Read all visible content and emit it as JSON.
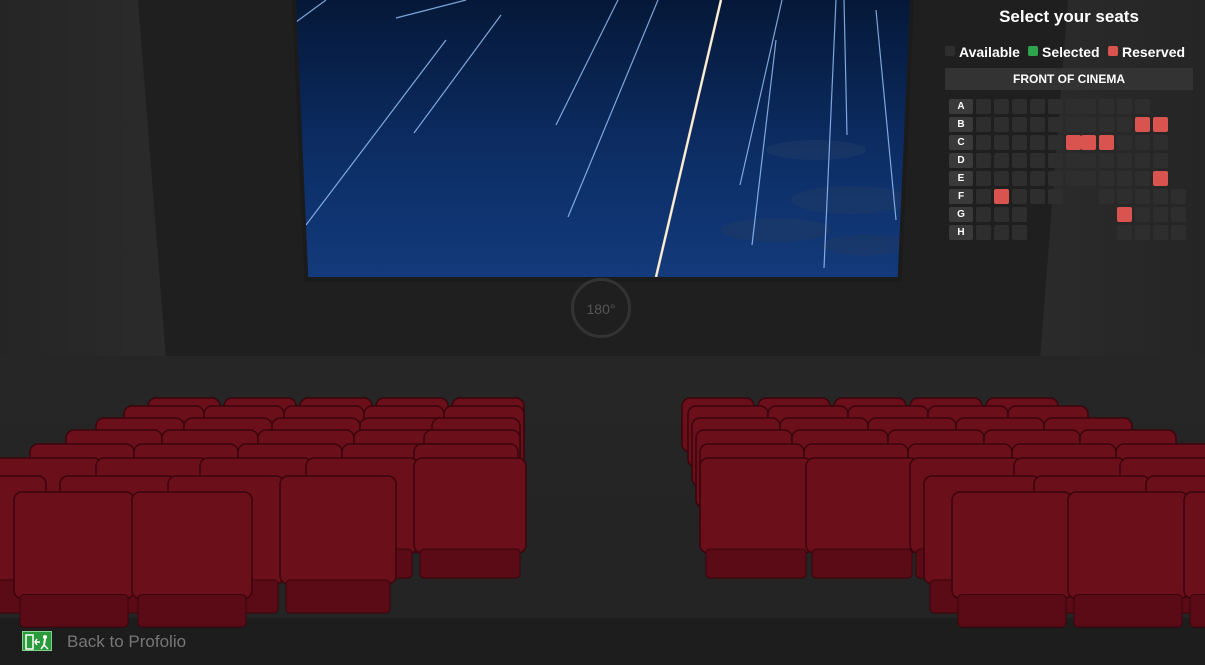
{
  "panel": {
    "title": "Select your seats",
    "front_label": "FRONT OF CINEMA",
    "legend": [
      {
        "label": "Available",
        "color": "#2e2e2e"
      },
      {
        "label": "Selected",
        "color": "#2ea44f"
      },
      {
        "label": "Reserved",
        "color": "#d9534f"
      }
    ],
    "rows": [
      {
        "label": "A",
        "left": [
          0,
          0,
          0,
          0,
          0,
          0
        ],
        "right": [
          0,
          0,
          0,
          0
        ]
      },
      {
        "label": "B",
        "left": [
          0,
          0,
          0,
          0,
          0,
          0
        ],
        "right": [
          0,
          0,
          0,
          2,
          2
        ]
      },
      {
        "label": "C",
        "left": [
          0,
          0,
          0,
          0,
          0,
          2
        ],
        "right": [
          2,
          2,
          0,
          0,
          0
        ]
      },
      {
        "label": "D",
        "left": [
          0,
          0,
          0,
          0,
          0,
          0
        ],
        "right": [
          0,
          0,
          0,
          0,
          0
        ]
      },
      {
        "label": "E",
        "left": [
          0,
          0,
          0,
          0,
          0,
          0
        ],
        "right": [
          0,
          0,
          0,
          0,
          2
        ]
      },
      {
        "label": "F",
        "left": [
          0,
          2,
          0,
          0,
          0
        ],
        "right": [
          0,
          0,
          0,
          0,
          0
        ]
      },
      {
        "label": "G",
        "left": [
          0,
          0,
          0
        ],
        "right": [
          2,
          0,
          0,
          0
        ]
      },
      {
        "label": "H",
        "left": [
          0,
          0,
          0
        ],
        "right": [
          0,
          0,
          0,
          0
        ]
      }
    ]
  },
  "stage": {
    "rotate_label": "180°"
  },
  "footer": {
    "back_label": "Back to Profolio",
    "exit_icon": "emergency-exit-icon"
  },
  "colors": {
    "seat_red": "#6b0f1a",
    "screen_blue": "#0d2f68"
  }
}
